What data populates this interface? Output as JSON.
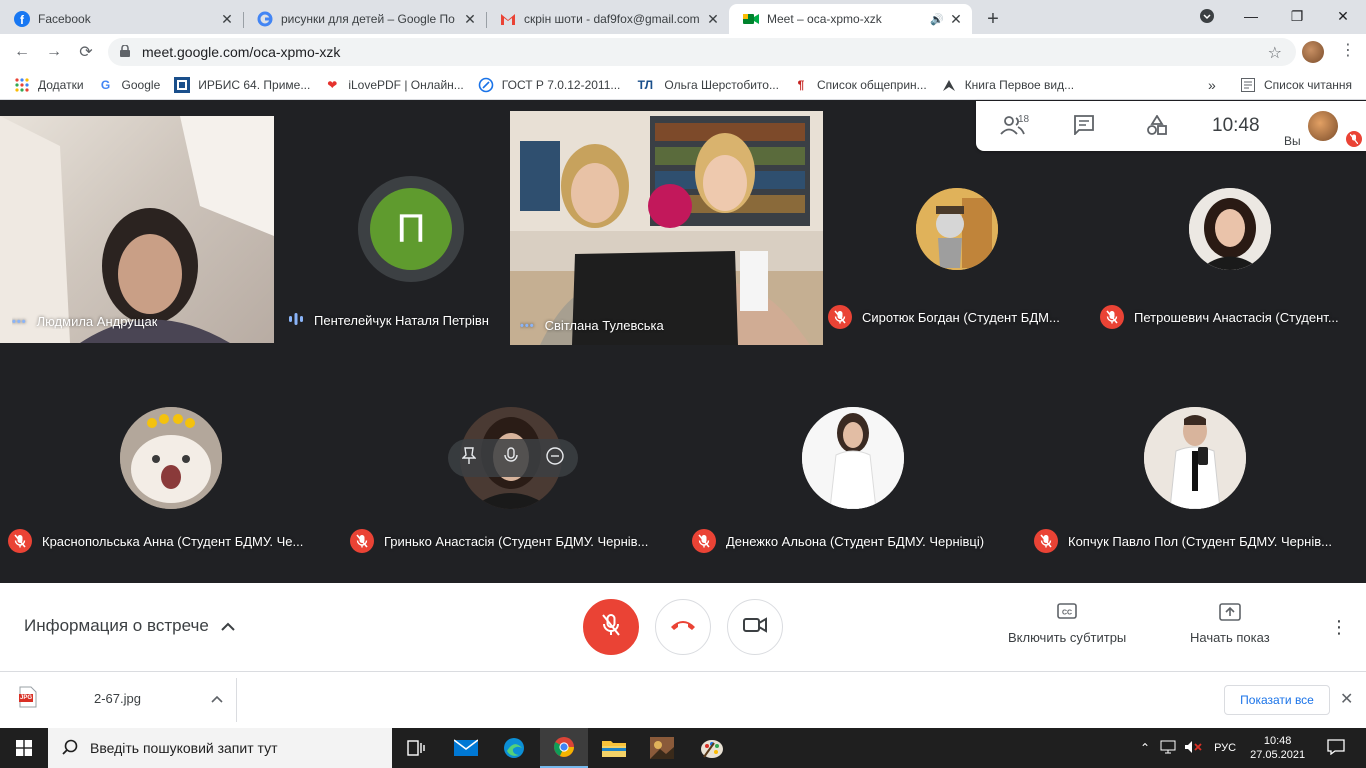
{
  "tabs": [
    {
      "title": "Facebook",
      "icon": "facebook-icon"
    },
    {
      "title": "рисунки для детей – Google По",
      "icon": "google-icon"
    },
    {
      "title": "скрін шоти - daf9fox@gmail.com",
      "icon": "gmail-icon"
    },
    {
      "title": "Meet – oca-xpmo-xzk",
      "icon": "meet-icon",
      "active": true
    }
  ],
  "address": {
    "url": "meet.google.com/oca-xpmo-xzk"
  },
  "bookmarks": [
    {
      "label": "Додатки",
      "icon": "apps-grid-icon"
    },
    {
      "label": "Google",
      "icon": "google-icon"
    },
    {
      "label": "ИРБИС 64. Приме...",
      "icon": "irbis-icon"
    },
    {
      "label": "iLovePDF | Онлайн...",
      "icon": "ilovepdf-icon"
    },
    {
      "label": "ГОСТ Р 7.0.12-2011...",
      "icon": "gost-icon"
    },
    {
      "label": "Ольга Шерстобито...",
      "icon": "tl-icon"
    },
    {
      "label": "Список общеприн...",
      "icon": "paragraph-icon"
    },
    {
      "label": "Книга Первое вид...",
      "icon": "book-icon"
    }
  ],
  "bookmarks_more": "»",
  "reading_list": "Список читання",
  "tl_text": "ТЛ",
  "topbar": {
    "participants_count": "18",
    "time": "10:48",
    "you_label": "Вы"
  },
  "participants": [
    {
      "name": "Людмила Андрущак",
      "status": "speaking"
    },
    {
      "name": "Пентелейчук Наталя Петрівн",
      "status": "speaking",
      "initial": "П"
    },
    {
      "name": "Світлана Тулевська",
      "status": "speaking"
    },
    {
      "name": "Сиротюк Богдан (Студент БДМ...",
      "status": "muted"
    },
    {
      "name": "Петрошевич Анастасія (Студент...",
      "status": "muted"
    },
    {
      "name": "Краснопольська Анна (Студент БДМУ. Че...",
      "status": "muted"
    },
    {
      "name": "Гринько Анастасія (Студент БДМУ. Чернів...",
      "status": "muted"
    },
    {
      "name": "Денежко Альона (Студент БДМУ. Чернівці)",
      "status": "muted"
    },
    {
      "name": "Копчук Павло Пол (Студент БДМУ. Чернів...",
      "status": "muted"
    }
  ],
  "controls": {
    "meeting_info": "Информация о встрече",
    "captions": "Включить субтитры",
    "present": "Начать показ"
  },
  "shelf": {
    "filename": "2-67.jpg",
    "file_badge": "JPG",
    "show_all": "Показати все"
  },
  "taskbar": {
    "search_placeholder": "Введіть пошуковий запит тут",
    "lang": "РУС",
    "time": "10:48",
    "date": "27.05.2021"
  },
  "colors": {
    "meet_bg": "#202124",
    "tile_bg": "#3c4043",
    "red": "#ea4335",
    "speaking": "#8ab4f8",
    "avatar_green": "#5f9b2e"
  }
}
